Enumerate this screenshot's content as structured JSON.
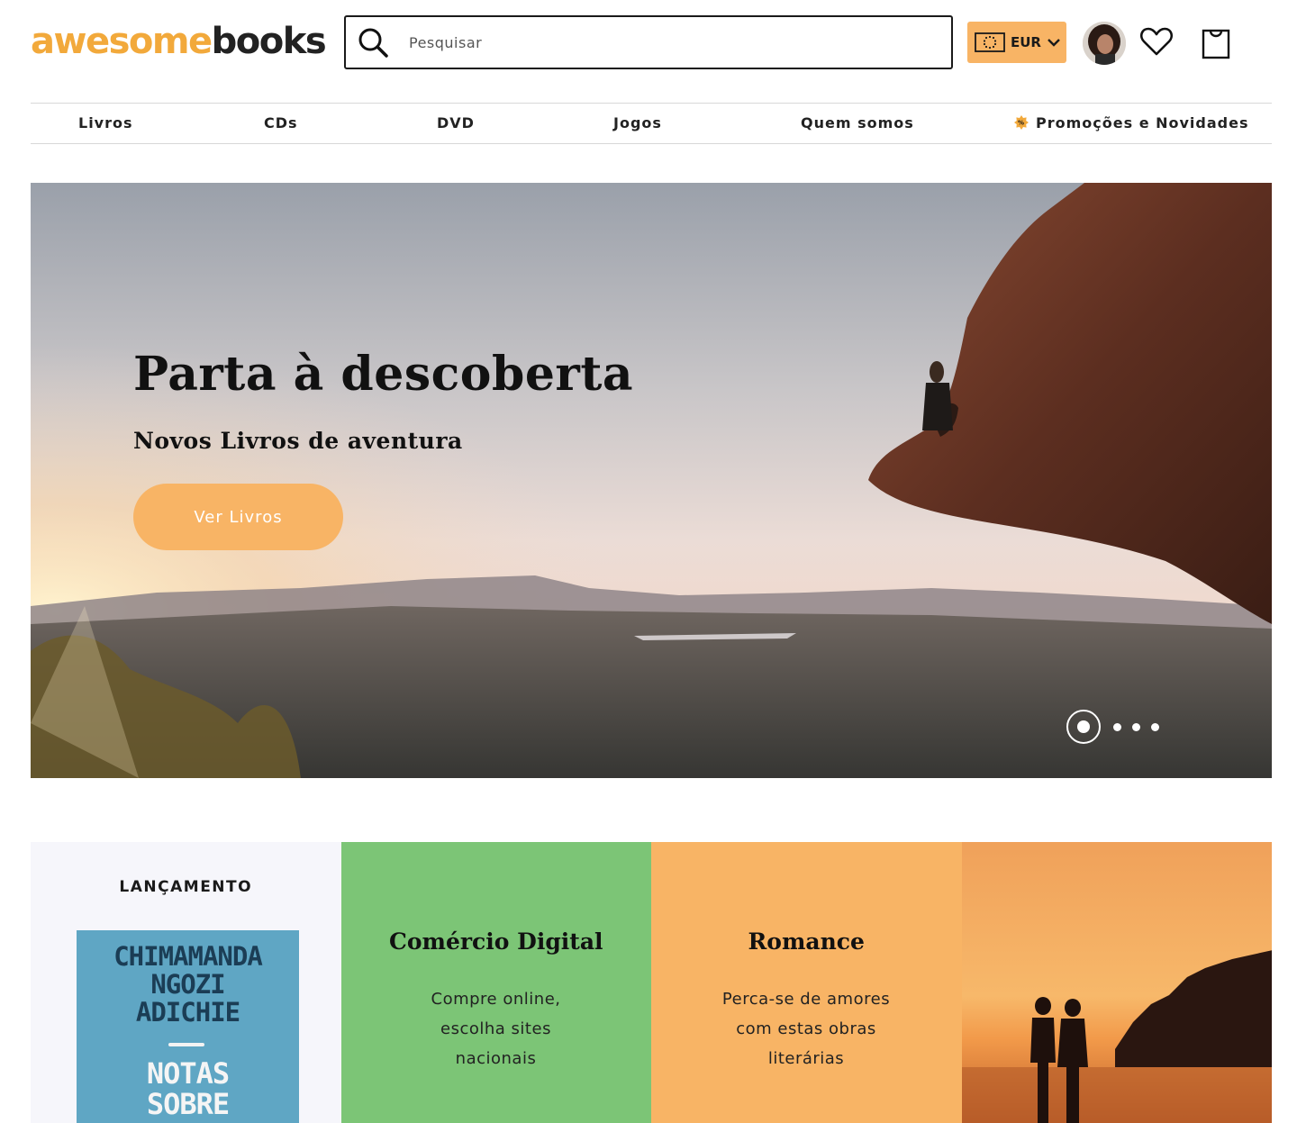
{
  "brand": {
    "part1": "awesome",
    "part2": "books",
    "accent_color": "#f2a93b"
  },
  "search": {
    "placeholder": "Pesquisar",
    "icon": "search-icon"
  },
  "currency": {
    "label": "EUR",
    "icon": "euro-flag-icon"
  },
  "header_icons": {
    "avatar": "user-avatar",
    "wishlist": "heart-icon",
    "cart": "shopping-bag-icon"
  },
  "nav": {
    "items": [
      {
        "label": "Livros"
      },
      {
        "label": "CDs"
      },
      {
        "label": "DVD"
      },
      {
        "label": "Jogos"
      },
      {
        "label": "Quem somos"
      },
      {
        "label": "Promoções e Novidades",
        "icon": "percent-badge-icon"
      }
    ]
  },
  "hero": {
    "title": "Parta à descoberta",
    "subtitle": "Novos Livros de aventura",
    "button": "Ver Livros",
    "slide_count": 4,
    "active_slide": 1
  },
  "tiles": {
    "launch": {
      "kicker": "LANÇAMENTO",
      "book_author_lines": [
        "CHIMAMANDA",
        "NGOZI",
        "ADICHIE"
      ],
      "book_title_lines": [
        "NOTAS",
        "SOBRE"
      ]
    },
    "digital": {
      "title": "Comércio Digital",
      "desc_lines": [
        "Compre online,",
        "escolha sites",
        "nacionais"
      ],
      "color": "#7cc576"
    },
    "romance": {
      "title": "Romance",
      "desc_lines": [
        "Perca-se de amores",
        "com estas obras",
        "literárias"
      ],
      "color": "#f8b465"
    }
  }
}
